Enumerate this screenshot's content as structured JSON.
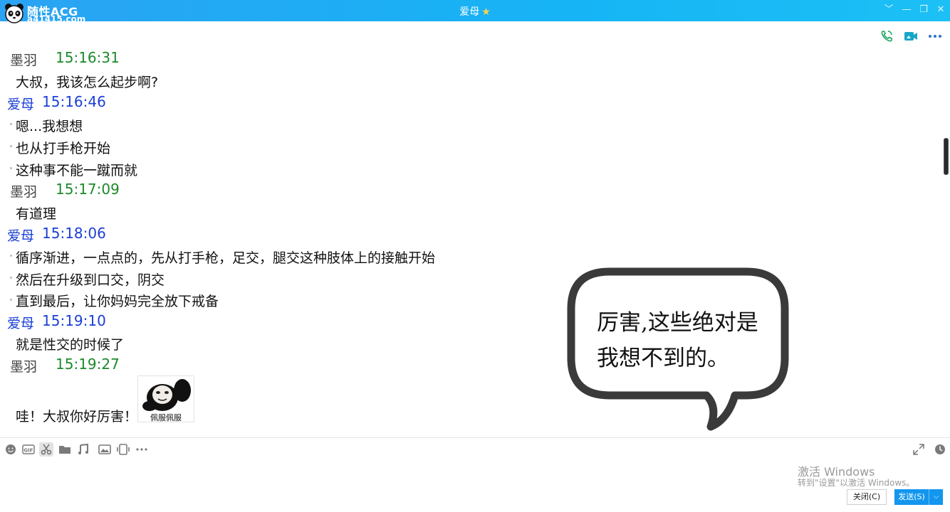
{
  "watermark": {
    "line1": "随性ACG",
    "line2": "a41415.com"
  },
  "window": {
    "title": "爱母",
    "star": "★",
    "controls": [
      "﹀",
      "—",
      "❐",
      "✕"
    ]
  },
  "colors": {
    "titlebar": "#16b4f5",
    "my_name": "#444444",
    "my_time": "#1b8a2a",
    "their_name": "#1a3fd6",
    "send_button": "#1296ee"
  },
  "header_icons": [
    "phone-icon",
    "video-call-icon",
    "more-icon"
  ],
  "chat": {
    "m1": {
      "sender": "墨羽",
      "time": "15:16:31",
      "text": "大叔，我该怎么起步啊?"
    },
    "m2": {
      "sender": "爱母",
      "time": "15:16:46",
      "lines": [
        "嗯...我想想",
        "也从打手枪开始",
        "这种事不能一蹴而就"
      ]
    },
    "m3": {
      "sender": "墨羽",
      "time": "15:17:09",
      "text": "有道理"
    },
    "m4": {
      "sender": "爱母",
      "time": "15:18:06",
      "lines": [
        "循序渐进，一点点的，先从打手枪，足交，腿交这种肢体上的接触开始",
        "然后在升级到口交，阴交",
        "直到最后，让你妈妈完全放下戒备"
      ]
    },
    "m5": {
      "sender": "爱母",
      "time": "15:19:10",
      "text": "就是性交的时候了"
    },
    "m6": {
      "sender": "墨羽",
      "time": "15:19:27",
      "text": "哇！大叔你好厉害！",
      "sticker_caption": "佩服佩服"
    }
  },
  "speech_bubble": {
    "line1": "厉害,这些绝对是",
    "line2": "我想不到的。"
  },
  "toolbar": {
    "left_icons": [
      "emoji-icon",
      "gif-icon",
      "scissors-icon",
      "folder-icon",
      "music-icon",
      "image-icon",
      "screen-record-icon",
      "more-icon"
    ],
    "right_icons": [
      "expand-icon",
      "history-clock-icon"
    ]
  },
  "windows_activation": {
    "line1": "激活 Windows",
    "line2": "转到\"设置\"以激活 Windows。"
  },
  "buttons": {
    "close": "关闭(C)",
    "send": "发送(S)",
    "send_menu": "⌵"
  }
}
